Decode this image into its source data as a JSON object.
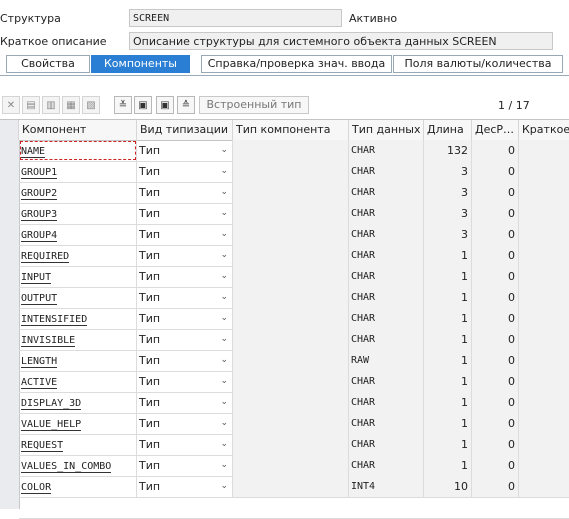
{
  "header": {
    "structure_label": "Структура",
    "structure_value": "SCREEN",
    "status": "Активно",
    "desc_label": "Краткое описание",
    "desc_value": "Описание структуры для системного объекта данных SCREEN"
  },
  "tabs": [
    {
      "label": "Свойства",
      "active": false
    },
    {
      "label": "Компоненты",
      "active": true
    },
    {
      "label": "Справка/проверка знач. ввода",
      "active": false
    },
    {
      "label": "Поля валюты/количества",
      "active": false
    }
  ],
  "toolbar": {
    "builtin_type_label": "Встроенный тип",
    "pager": "1 / 17",
    "icons": [
      "cut-icon",
      "copy-icon",
      "paste-icon",
      "insert-row-icon",
      "delete-row-icon",
      "collapse-icon",
      "first-page-icon",
      "last-page-icon",
      "expand-icon"
    ]
  },
  "grid": {
    "columns": [
      "Компонент",
      "Вид типизации",
      "Тип компонента",
      "Тип данных",
      "Длина",
      "ДесР…",
      "Краткое"
    ],
    "rows": [
      {
        "name": "NAME",
        "kind": "Тип",
        "type": "",
        "dtype": "CHAR",
        "len": "132",
        "dec": "0"
      },
      {
        "name": "GROUP1",
        "kind": "Тип",
        "type": "",
        "dtype": "CHAR",
        "len": "3",
        "dec": "0"
      },
      {
        "name": "GROUP2",
        "kind": "Тип",
        "type": "",
        "dtype": "CHAR",
        "len": "3",
        "dec": "0"
      },
      {
        "name": "GROUP3",
        "kind": "Тип",
        "type": "",
        "dtype": "CHAR",
        "len": "3",
        "dec": "0"
      },
      {
        "name": "GROUP4",
        "kind": "Тип",
        "type": "",
        "dtype": "CHAR",
        "len": "3",
        "dec": "0"
      },
      {
        "name": "REQUIRED",
        "kind": "Тип",
        "type": "",
        "dtype": "CHAR",
        "len": "1",
        "dec": "0"
      },
      {
        "name": "INPUT",
        "kind": "Тип",
        "type": "",
        "dtype": "CHAR",
        "len": "1",
        "dec": "0"
      },
      {
        "name": "OUTPUT",
        "kind": "Тип",
        "type": "",
        "dtype": "CHAR",
        "len": "1",
        "dec": "0"
      },
      {
        "name": "INTENSIFIED",
        "kind": "Тип",
        "type": "",
        "dtype": "CHAR",
        "len": "1",
        "dec": "0"
      },
      {
        "name": "INVISIBLE",
        "kind": "Тип",
        "type": "",
        "dtype": "CHAR",
        "len": "1",
        "dec": "0"
      },
      {
        "name": "LENGTH",
        "kind": "Тип",
        "type": "",
        "dtype": "RAW",
        "len": "1",
        "dec": "0"
      },
      {
        "name": "ACTIVE",
        "kind": "Тип",
        "type": "",
        "dtype": "CHAR",
        "len": "1",
        "dec": "0"
      },
      {
        "name": "DISPLAY_3D",
        "kind": "Тип",
        "type": "",
        "dtype": "CHAR",
        "len": "1",
        "dec": "0"
      },
      {
        "name": "VALUE_HELP",
        "kind": "Тип",
        "type": "",
        "dtype": "CHAR",
        "len": "1",
        "dec": "0"
      },
      {
        "name": "REQUEST",
        "kind": "Тип",
        "type": "",
        "dtype": "CHAR",
        "len": "1",
        "dec": "0"
      },
      {
        "name": "VALUES_IN_COMBO",
        "kind": "Тип",
        "type": "",
        "dtype": "CHAR",
        "len": "1",
        "dec": "0"
      },
      {
        "name": "COLOR",
        "kind": "Тип",
        "type": "",
        "dtype": "INT4",
        "len": "10",
        "dec": "0"
      }
    ]
  },
  "colors": {
    "tab_active": "#2a7fd4",
    "focus": "#cc2222"
  }
}
